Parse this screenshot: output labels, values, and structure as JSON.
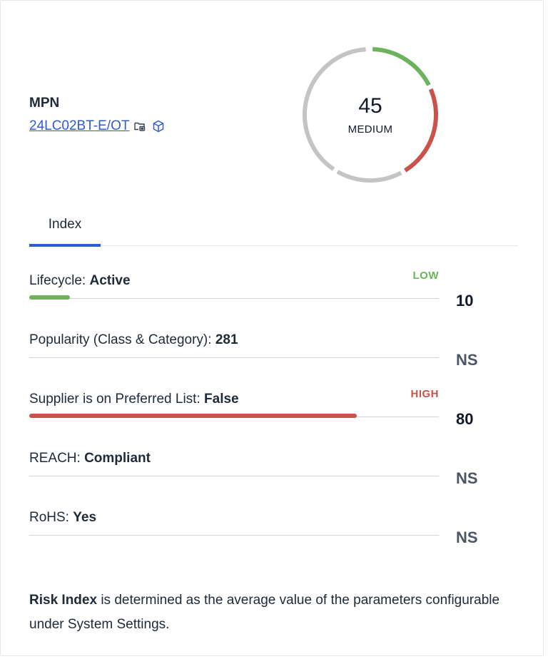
{
  "header": {
    "mpn_label": "MPN",
    "mpn_value": "24LC02BT-E/OT",
    "icons": [
      "copy-folder-icon",
      "3d-model-icon"
    ]
  },
  "risk_gauge": {
    "value": "45",
    "label": "MEDIUM",
    "colors": {
      "track": "#c4c4c4",
      "low": "#6cb35b",
      "high": "#c9534a"
    }
  },
  "tabs": [
    {
      "label": "Index",
      "active": true
    }
  ],
  "parameters": [
    {
      "label": "Lifecycle: ",
      "value": "Active",
      "badge": "LOW",
      "badge_color": "#6cb35b",
      "score": "10",
      "score_color": "#111827",
      "level": 0.1,
      "fill_color": "#6cb35b"
    },
    {
      "label": "Popularity (Class & Category): ",
      "value": "281",
      "badge": "",
      "badge_color": "",
      "score": "NS",
      "score_color": "#4b5563",
      "level": 0,
      "fill_color": ""
    },
    {
      "label": "Supplier is on Preferred List: ",
      "value": "False",
      "badge": "HIGH",
      "badge_color": "#c9534a",
      "score": "80",
      "score_color": "#111827",
      "level": 0.8,
      "fill_color": "#c9534a"
    },
    {
      "label": "REACH: ",
      "value": "Compliant",
      "badge": "",
      "badge_color": "",
      "score": "NS",
      "score_color": "#4b5563",
      "level": 0,
      "fill_color": ""
    },
    {
      "label": "RoHS: ",
      "value": "Yes",
      "badge": "",
      "badge_color": "",
      "score": "NS",
      "score_color": "#4b5563",
      "level": 0,
      "fill_color": ""
    }
  ],
  "note": {
    "bold": "Risk Index",
    "text": " is determined as the average value of the parameters configurable under System Settings."
  }
}
